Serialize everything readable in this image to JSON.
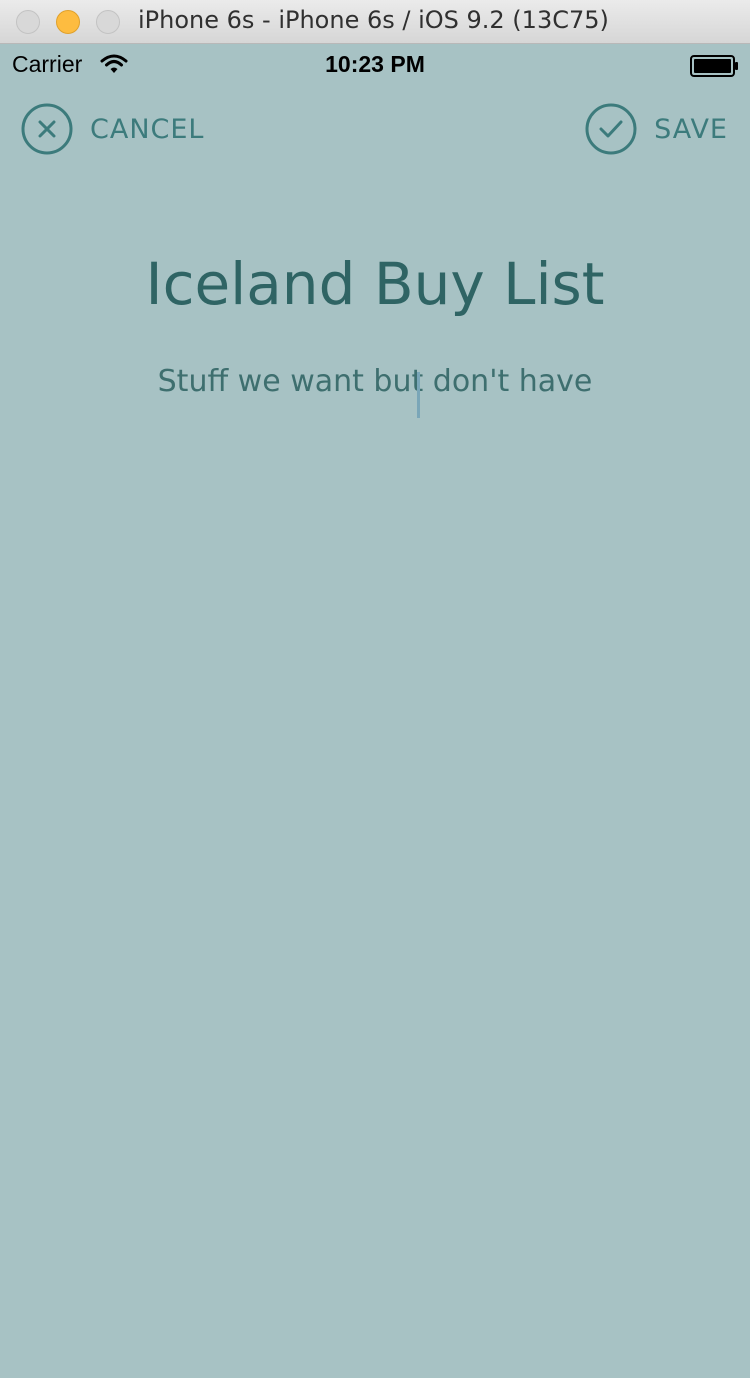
{
  "window": {
    "title": "iPhone 6s - iPhone 6s / iOS 9.2 (13C75)"
  },
  "status_bar": {
    "carrier": "Carrier",
    "time": "10:23 PM"
  },
  "nav": {
    "cancel_label": "CANCEL",
    "save_label": "SAVE"
  },
  "form": {
    "title_value": "Iceland Buy List",
    "subtitle_value": "Stuff we want but don't have"
  },
  "colors": {
    "background": "#a7c2c4",
    "accent": "#3c7b7c",
    "title_text": "#2f6464"
  },
  "icons": [
    "wifi-icon",
    "battery-icon",
    "close-circle-icon",
    "checkmark-circle-icon"
  ]
}
